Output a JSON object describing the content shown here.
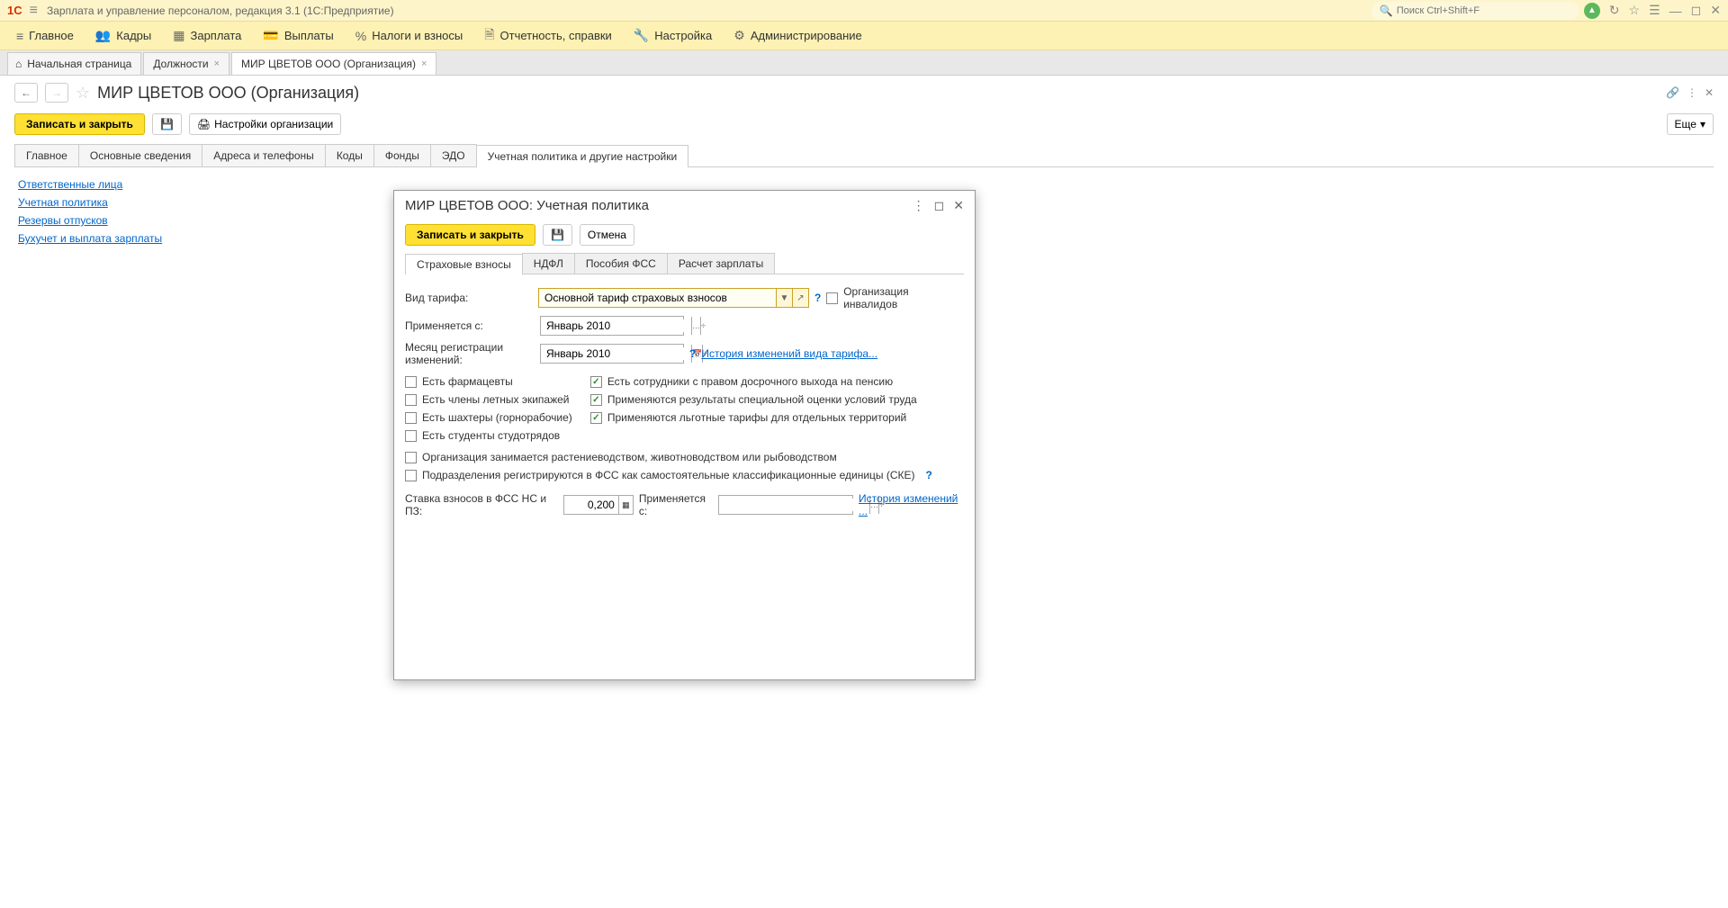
{
  "app": {
    "title": "Зарплата и управление персоналом, редакция 3.1  (1С:Предприятие)",
    "search_placeholder": "Поиск Ctrl+Shift+F"
  },
  "menu": {
    "main": "Главное",
    "personnel": "Кадры",
    "salary": "Зарплата",
    "payments": "Выплаты",
    "taxes": "Налоги и взносы",
    "reports": "Отчетность, справки",
    "settings": "Настройка",
    "admin": "Администрирование"
  },
  "tabs": {
    "home": "Начальная страница",
    "positions": "Должности",
    "org": "МИР ЦВЕТОВ ООО (Организация)"
  },
  "page": {
    "title": "МИР ЦВЕТОВ ООО (Организация)",
    "save_close": "Записать и закрыть",
    "org_settings": "Настройки организации",
    "more": "Еще"
  },
  "ptabs": {
    "main": "Главное",
    "basic": "Основные сведения",
    "addr": "Адреса и телефоны",
    "codes": "Коды",
    "funds": "Фонды",
    "edo": "ЭДО",
    "policy": "Учетная политика и другие настройки"
  },
  "links": {
    "resp": "Ответственные лица",
    "policy": "Учетная политика",
    "vacation": "Резервы отпусков",
    "accounting": "Бухучет и выплата зарплаты"
  },
  "modal": {
    "title": "МИР ЦВЕТОВ ООО: Учетная политика",
    "save_close": "Записать и закрыть",
    "cancel": "Отмена",
    "tabs": {
      "insurance": "Страховые взносы",
      "ndfl": "НДФЛ",
      "fss": "Пособия ФСС",
      "calc": "Расчет зарплаты"
    },
    "form": {
      "tariff_label": "Вид тарифа:",
      "tariff_value": "Основной тариф страховых взносов",
      "invalid_org": "Организация инвалидов",
      "applies_from": "Применяется с:",
      "applies_from_value": "Январь 2010",
      "change_month": "Месяц регистрации изменений:",
      "change_month_value": "Январь 2010",
      "history_tariff": "История изменений вида тарифа...",
      "pharmacists": "Есть фармацевты",
      "flight_crew": "Есть члены летных экипажей",
      "miners": "Есть шахтеры (горнорабочие)",
      "students": "Есть студенты студотрядов",
      "early_pension": "Есть сотрудники с правом досрочного выхода на пенсию",
      "special_assessment": "Применяются результаты специальной оценки условий труда",
      "preferential": "Применяются льготные тарифы для отдельных территорий",
      "farming": "Организация занимается растениеводством, животноводством или рыбоводством",
      "fss_units": "Подразделения регистрируются в ФСС как самостоятельные классификационные единицы (СКЕ)",
      "fss_rate_label": "Ставка взносов в ФСС НС и ПЗ:",
      "fss_rate_value": "0,200",
      "applies_from2": "Применяется с:",
      "history": "История изменений ..."
    }
  }
}
